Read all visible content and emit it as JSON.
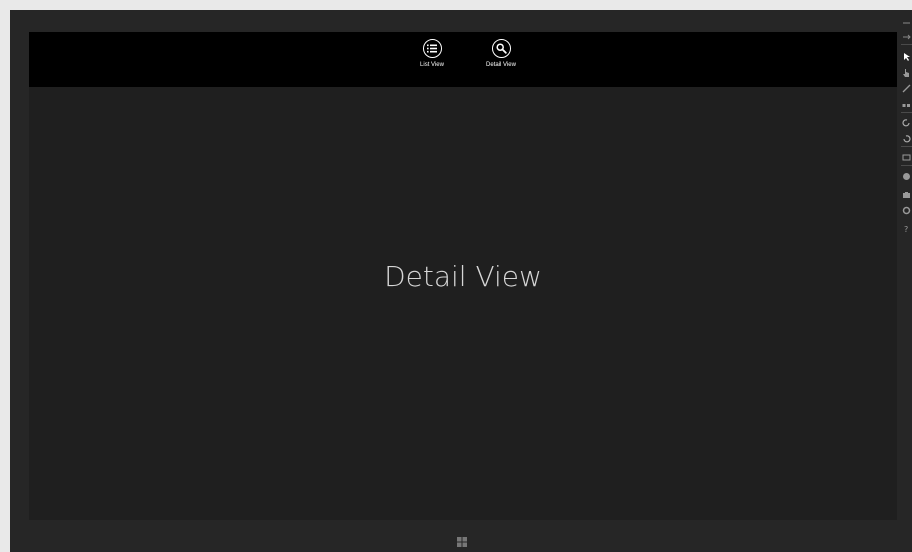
{
  "app_bar": {
    "buttons": [
      {
        "label": "List View",
        "icon": "list-icon"
      },
      {
        "label": "Detail View",
        "icon": "search-icon"
      }
    ]
  },
  "main": {
    "title": "Detail View"
  },
  "toolbar": {
    "tools": [
      "minimize-icon",
      "pin-icon",
      "pointer-icon",
      "touch-icon",
      "pinch-zoom-icon",
      "rotate-icon",
      "rotate-clockwise-icon",
      "rotate-counterclockwise-icon",
      "resolution-icon",
      "location-icon",
      "screenshot-icon",
      "settings-icon",
      "help-icon"
    ]
  },
  "colors": {
    "frame": "#262626",
    "screen": "#1f1f1f",
    "app_bar": "#000000",
    "text": "#ffffff"
  }
}
